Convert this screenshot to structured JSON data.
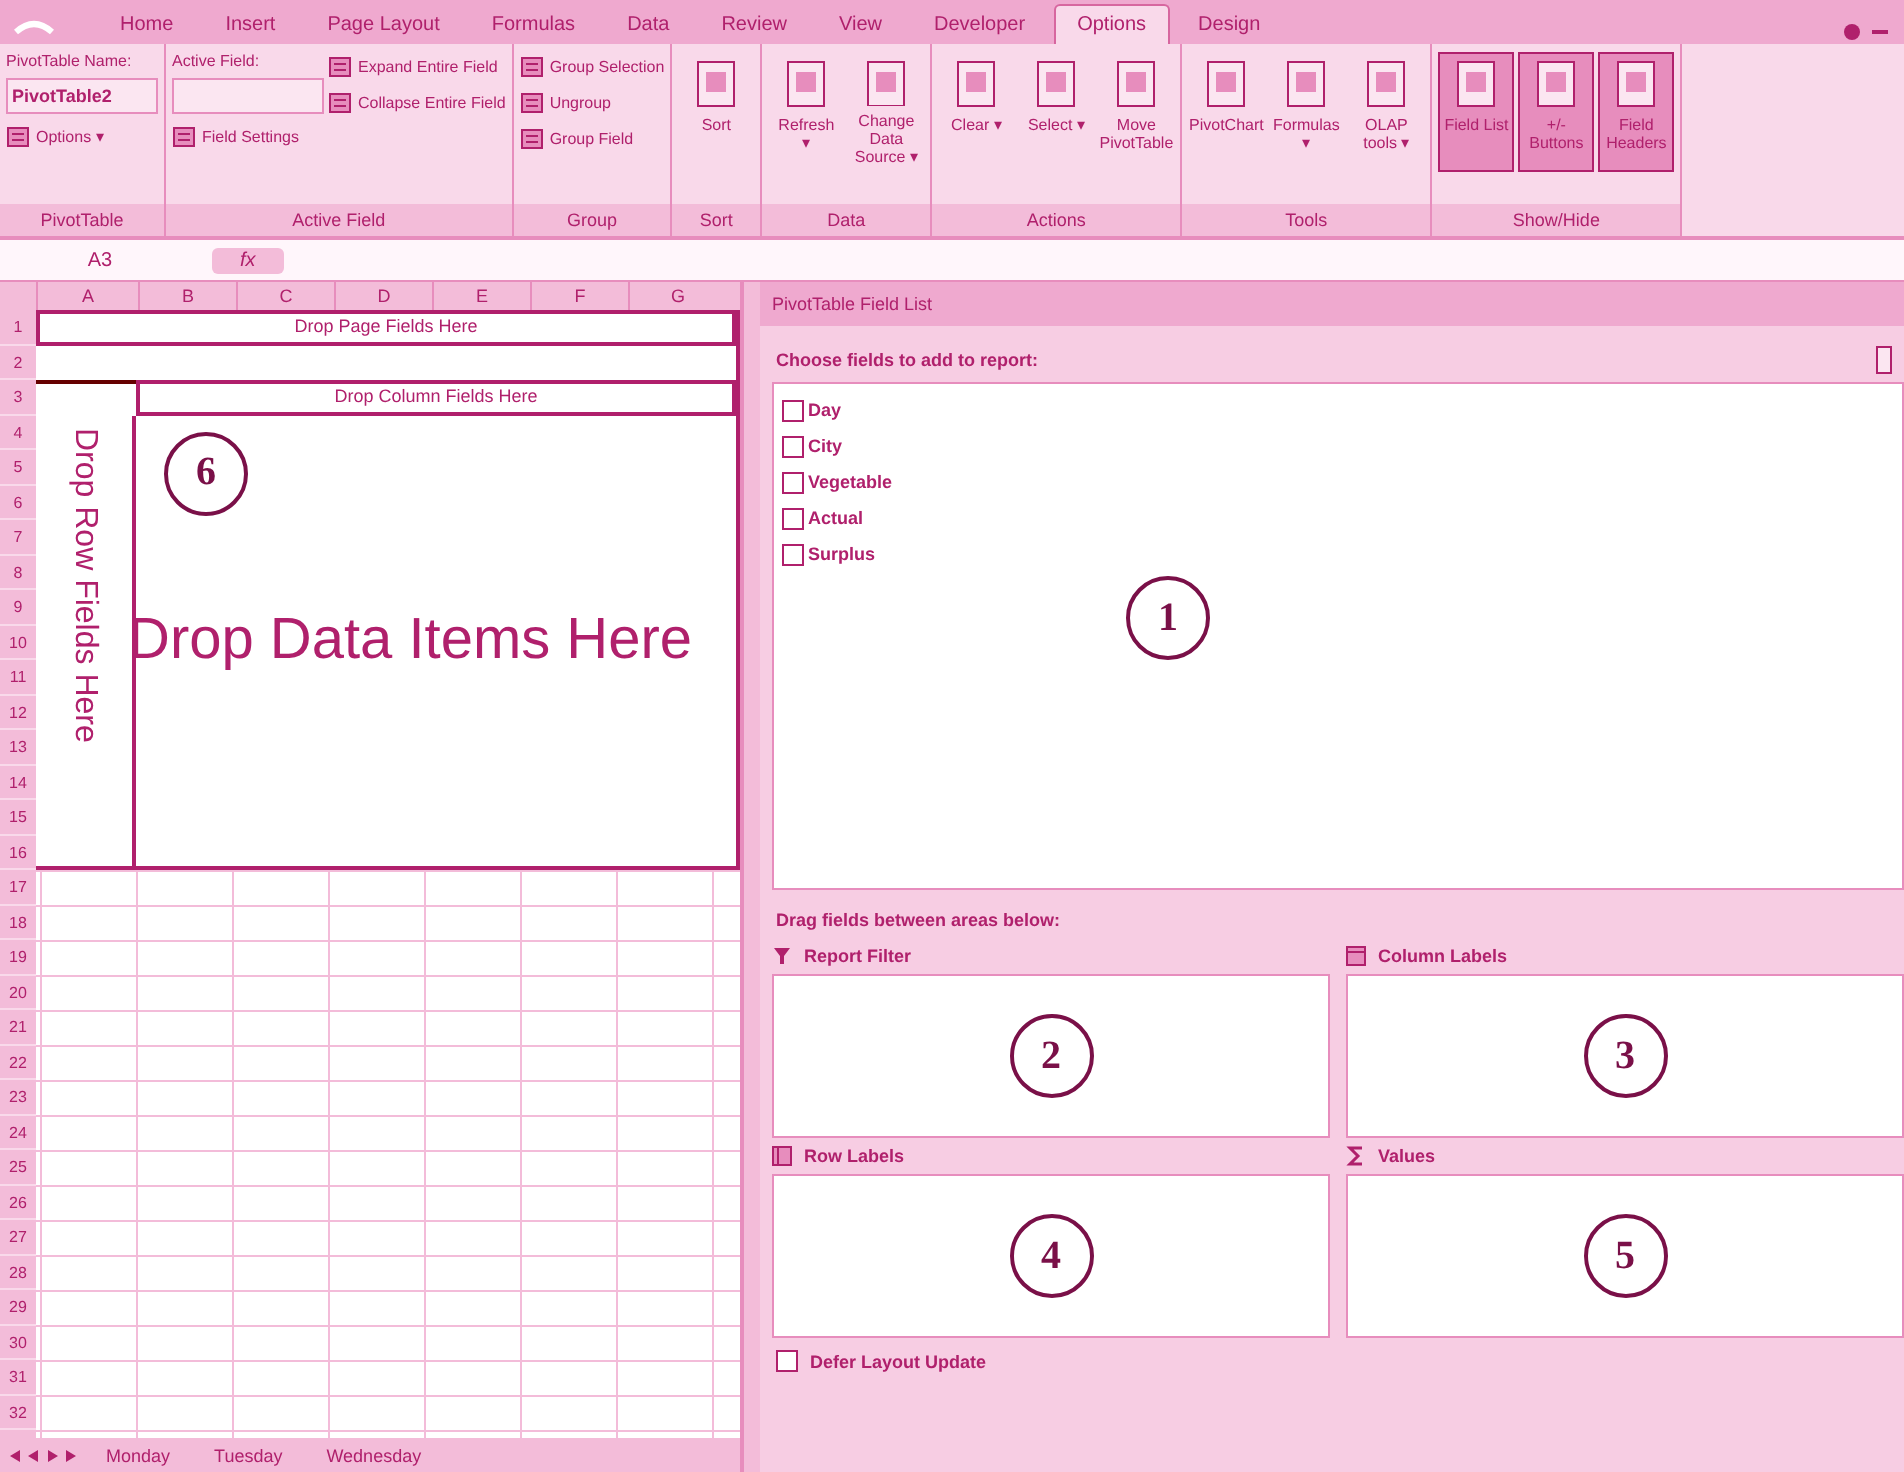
{
  "ribbon_tabs": [
    {
      "label": "Home",
      "selected": false
    },
    {
      "label": "Insert",
      "selected": false
    },
    {
      "label": "Page Layout",
      "selected": false
    },
    {
      "label": "Formulas",
      "selected": false
    },
    {
      "label": "Data",
      "selected": false
    },
    {
      "label": "Review",
      "selected": false
    },
    {
      "label": "View",
      "selected": false
    },
    {
      "label": "Developer",
      "selected": false
    },
    {
      "label": "Options",
      "selected": true
    },
    {
      "label": "Design",
      "selected": false
    }
  ],
  "ribbon_groups": [
    {
      "title": "PivotTable",
      "columns": [
        [
          {
            "kind": "label",
            "text": "PivotTable Name:"
          },
          {
            "kind": "field",
            "text": "PivotTable2"
          },
          {
            "kind": "small",
            "text": "Options ▾"
          }
        ]
      ]
    },
    {
      "title": "Active Field",
      "columns": [
        [
          {
            "kind": "label",
            "text": "Active Field:"
          },
          {
            "kind": "field",
            "text": ""
          },
          {
            "kind": "small",
            "text": "Field Settings"
          }
        ],
        [
          {
            "kind": "small",
            "text": "Expand Entire Field"
          },
          {
            "kind": "small",
            "text": "Collapse Entire Field"
          }
        ]
      ]
    },
    {
      "title": "Group",
      "columns": [
        [
          {
            "kind": "small",
            "text": "Group Selection"
          },
          {
            "kind": "small",
            "text": "Ungroup"
          },
          {
            "kind": "small",
            "text": "Group Field"
          }
        ]
      ]
    },
    {
      "title": "Sort",
      "columns": [
        [
          {
            "kind": "large",
            "text": "Sort",
            "on": false
          }
        ]
      ]
    },
    {
      "title": "Data",
      "columns": [
        [
          {
            "kind": "large",
            "text": "Refresh ▾",
            "on": false
          }
        ],
        [
          {
            "kind": "large",
            "text": "Change Data Source ▾",
            "on": false
          }
        ]
      ]
    },
    {
      "title": "Actions",
      "columns": [
        [
          {
            "kind": "large",
            "text": "Clear ▾",
            "on": false
          }
        ],
        [
          {
            "kind": "large",
            "text": "Select ▾",
            "on": false
          }
        ],
        [
          {
            "kind": "large",
            "text": "Move PivotTable",
            "on": false
          }
        ]
      ]
    },
    {
      "title": "Tools",
      "columns": [
        [
          {
            "kind": "large",
            "text": "PivotChart",
            "on": false
          }
        ],
        [
          {
            "kind": "large",
            "text": "Formulas ▾",
            "on": false
          }
        ],
        [
          {
            "kind": "large",
            "text": "OLAP tools ▾",
            "on": false
          }
        ]
      ]
    },
    {
      "title": "Show/Hide",
      "columns": [
        [
          {
            "kind": "large",
            "text": "Field List",
            "on": true
          }
        ],
        [
          {
            "kind": "large",
            "text": "+/- Buttons",
            "on": true
          }
        ],
        [
          {
            "kind": "large",
            "text": "Field Headers",
            "on": true
          }
        ]
      ]
    }
  ],
  "formula_bar": {
    "name_box": "A3",
    "function_button": "fx"
  },
  "sheet": {
    "columns": [
      "A",
      "B",
      "C",
      "D",
      "E",
      "F",
      "G"
    ],
    "row_numbers": [
      "1",
      "2",
      "3",
      "4",
      "5",
      "6",
      "7",
      "8",
      "9",
      "10",
      "11",
      "12",
      "13",
      "14",
      "15",
      "16",
      "17",
      "18",
      "19",
      "20",
      "21",
      "22",
      "23",
      "24",
      "25",
      "26",
      "27",
      "28",
      "29",
      "30",
      "31",
      "32"
    ],
    "pivot": {
      "page_fields": "Drop Page Fields Here",
      "column_fields": "Drop Column Fields Here",
      "row_fields": "Drop Row Fields Here",
      "data_items": "Drop Data Items Here",
      "callout": "6"
    },
    "sheet_tabs": [
      {
        "label": "Monday",
        "selected": false
      },
      {
        "label": "Tuesday",
        "selected": false
      },
      {
        "label": "Wednesday",
        "selected": false
      }
    ]
  },
  "field_list": {
    "title": "PivotTable Field List",
    "prompt": "Choose fields to add to report:",
    "fields": [
      {
        "label": "Day",
        "checked": false
      },
      {
        "label": "City",
        "checked": false
      },
      {
        "label": "Vegetable",
        "checked": false
      },
      {
        "label": "Actual",
        "checked": false
      },
      {
        "label": "Surplus",
        "checked": false
      }
    ],
    "callout": "1",
    "areas_prompt": "Drag fields between areas below:",
    "areas": [
      {
        "kind": "filter",
        "label": "Report Filter",
        "callout": "2"
      },
      {
        "kind": "columns",
        "label": "Column Labels",
        "callout": "3"
      },
      {
        "kind": "rows",
        "label": "Row Labels",
        "callout": "4"
      },
      {
        "kind": "values",
        "label": "Values",
        "callout": "5"
      }
    ],
    "defer_update": {
      "label": "Defer Layout Update",
      "checked": false
    }
  }
}
